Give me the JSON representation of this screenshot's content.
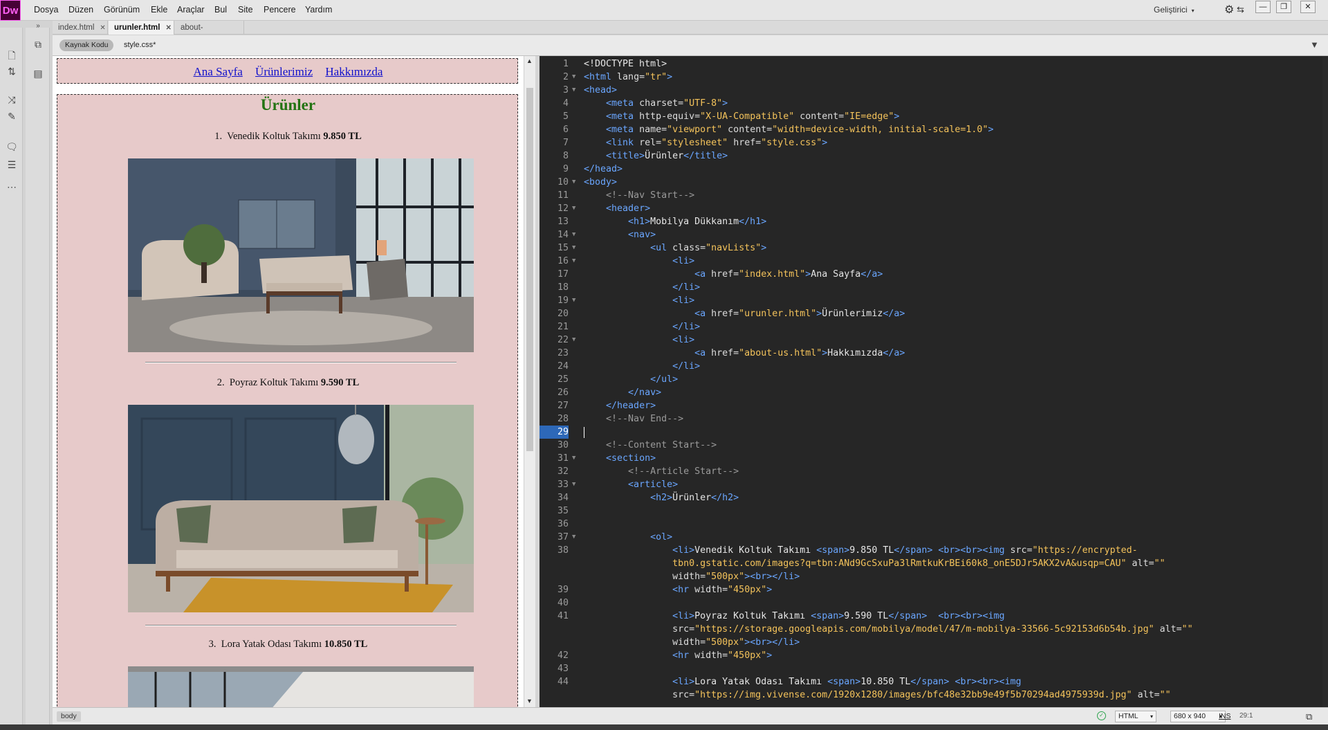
{
  "app": {
    "logo": "Dw"
  },
  "menu": [
    "Dosya",
    "Düzen",
    "Görünüm",
    "Ekle",
    "Araçlar",
    "Bul",
    "Site",
    "Pencere",
    "Yardım"
  ],
  "workspace": {
    "label": "Geliştirici",
    "arrow": "▾"
  },
  "window_controls": {
    "minimize": "—",
    "restore": "❐",
    "close": "✕"
  },
  "tabs": [
    {
      "label": "index.html",
      "close": "✕"
    },
    {
      "label": "urunler.html",
      "close": "✕"
    },
    {
      "label": "about-us.html",
      "close": "✕"
    }
  ],
  "related_files": {
    "source": "Kaynak Kodu",
    "css": "style.css*"
  },
  "live": {
    "nav": [
      "Ana Sayfa",
      "Ürünlerimiz",
      "Hakkımızda"
    ],
    "heading": "Ürünler",
    "products": [
      {
        "num": "1.",
        "name": "Venedik Koltuk Takımı",
        "price": "9.850 TL"
      },
      {
        "num": "2.",
        "name": "Poyraz Koltuk Takımı",
        "price": "9.590 TL"
      },
      {
        "num": "3.",
        "name": "Lora Yatak Odası Takımı",
        "price": "10.850 TL"
      }
    ]
  },
  "code": {
    "current_line": 29,
    "lines": [
      {
        "n": "1",
        "fold": "",
        "segs": [
          [
            "t",
            "<!DOCTYPE html>"
          ]
        ]
      },
      {
        "n": "2",
        "fold": "▼",
        "segs": [
          [
            "g",
            "<html "
          ],
          [
            "a",
            "lang="
          ],
          [
            "s",
            "\"tr\""
          ],
          [
            "g",
            ">"
          ]
        ]
      },
      {
        "n": "3",
        "fold": "▼",
        "segs": [
          [
            "g",
            "<head>"
          ]
        ]
      },
      {
        "n": "4",
        "fold": "",
        "segs": [
          [
            "t",
            "    "
          ],
          [
            "g",
            "<meta "
          ],
          [
            "a",
            "charset="
          ],
          [
            "s",
            "\"UTF-8\""
          ],
          [
            "g",
            ">"
          ]
        ]
      },
      {
        "n": "5",
        "fold": "",
        "segs": [
          [
            "t",
            "    "
          ],
          [
            "g",
            "<meta "
          ],
          [
            "a",
            "http-equiv="
          ],
          [
            "s",
            "\"X-UA-Compatible\""
          ],
          [
            "a",
            " content="
          ],
          [
            "s",
            "\"IE=edge\""
          ],
          [
            "g",
            ">"
          ]
        ]
      },
      {
        "n": "6",
        "fold": "",
        "segs": [
          [
            "t",
            "    "
          ],
          [
            "g",
            "<meta "
          ],
          [
            "a",
            "name="
          ],
          [
            "s",
            "\"viewport\""
          ],
          [
            "a",
            " content="
          ],
          [
            "s",
            "\"width=device-width, initial-scale=1.0\""
          ],
          [
            "g",
            ">"
          ]
        ]
      },
      {
        "n": "7",
        "fold": "",
        "segs": [
          [
            "t",
            "    "
          ],
          [
            "g",
            "<link "
          ],
          [
            "a",
            "rel="
          ],
          [
            "s",
            "\"stylesheet\""
          ],
          [
            "a",
            " href="
          ],
          [
            "s",
            "\"style.css\""
          ],
          [
            "g",
            ">"
          ]
        ]
      },
      {
        "n": "8",
        "fold": "",
        "segs": [
          [
            "t",
            "    "
          ],
          [
            "g",
            "<title>"
          ],
          [
            "t",
            "Ürünler"
          ],
          [
            "g",
            "</title>"
          ]
        ]
      },
      {
        "n": "9",
        "fold": "",
        "segs": [
          [
            "g",
            "</head>"
          ]
        ]
      },
      {
        "n": "10",
        "fold": "▼",
        "segs": [
          [
            "g",
            "<body>"
          ]
        ]
      },
      {
        "n": "11",
        "fold": "",
        "segs": [
          [
            "t",
            "    "
          ],
          [
            "c",
            "<!--Nav Start-->"
          ]
        ]
      },
      {
        "n": "12",
        "fold": "▼",
        "segs": [
          [
            "t",
            "    "
          ],
          [
            "g",
            "<header>"
          ]
        ]
      },
      {
        "n": "13",
        "fold": "",
        "segs": [
          [
            "t",
            "        "
          ],
          [
            "g",
            "<h1>"
          ],
          [
            "t",
            "Mobilya Dükkanım"
          ],
          [
            "g",
            "</h1>"
          ]
        ]
      },
      {
        "n": "14",
        "fold": "▼",
        "segs": [
          [
            "t",
            "        "
          ],
          [
            "g",
            "<nav>"
          ]
        ]
      },
      {
        "n": "15",
        "fold": "▼",
        "segs": [
          [
            "t",
            "            "
          ],
          [
            "g",
            "<ul "
          ],
          [
            "a",
            "class="
          ],
          [
            "s",
            "\"navLists\""
          ],
          [
            "g",
            ">"
          ]
        ]
      },
      {
        "n": "16",
        "fold": "▼",
        "segs": [
          [
            "t",
            "                "
          ],
          [
            "g",
            "<li>"
          ]
        ]
      },
      {
        "n": "17",
        "fold": "",
        "segs": [
          [
            "t",
            "                    "
          ],
          [
            "g",
            "<a "
          ],
          [
            "a",
            "href="
          ],
          [
            "s",
            "\"index.html\""
          ],
          [
            "g",
            ">"
          ],
          [
            "t",
            "Ana Sayfa"
          ],
          [
            "g",
            "</a>"
          ]
        ]
      },
      {
        "n": "18",
        "fold": "",
        "segs": [
          [
            "t",
            "                "
          ],
          [
            "g",
            "</li>"
          ]
        ]
      },
      {
        "n": "19",
        "fold": "▼",
        "segs": [
          [
            "t",
            "                "
          ],
          [
            "g",
            "<li>"
          ]
        ]
      },
      {
        "n": "20",
        "fold": "",
        "segs": [
          [
            "t",
            "                    "
          ],
          [
            "g",
            "<a "
          ],
          [
            "a",
            "href="
          ],
          [
            "s",
            "\"urunler.html\""
          ],
          [
            "g",
            ">"
          ],
          [
            "t",
            "Ürünlerimiz"
          ],
          [
            "g",
            "</a>"
          ]
        ]
      },
      {
        "n": "21",
        "fold": "",
        "segs": [
          [
            "t",
            "                "
          ],
          [
            "g",
            "</li>"
          ]
        ]
      },
      {
        "n": "22",
        "fold": "▼",
        "segs": [
          [
            "t",
            "                "
          ],
          [
            "g",
            "<li>"
          ]
        ]
      },
      {
        "n": "23",
        "fold": "",
        "segs": [
          [
            "t",
            "                    "
          ],
          [
            "g",
            "<a "
          ],
          [
            "a",
            "href="
          ],
          [
            "s",
            "\"about-us.html\""
          ],
          [
            "g",
            ">"
          ],
          [
            "t",
            "Hakkımızda"
          ],
          [
            "g",
            "</a>"
          ]
        ]
      },
      {
        "n": "24",
        "fold": "",
        "segs": [
          [
            "t",
            "                "
          ],
          [
            "g",
            "</li>"
          ]
        ]
      },
      {
        "n": "25",
        "fold": "",
        "segs": [
          [
            "t",
            "            "
          ],
          [
            "g",
            "</ul>"
          ]
        ]
      },
      {
        "n": "26",
        "fold": "",
        "segs": [
          [
            "t",
            "        "
          ],
          [
            "g",
            "</nav>"
          ]
        ]
      },
      {
        "n": "27",
        "fold": "",
        "segs": [
          [
            "t",
            "    "
          ],
          [
            "g",
            "</header>"
          ]
        ]
      },
      {
        "n": "28",
        "fold": "",
        "segs": [
          [
            "t",
            "    "
          ],
          [
            "c",
            "<!--Nav End-->"
          ]
        ]
      },
      {
        "n": "29",
        "fold": "",
        "segs": []
      },
      {
        "n": "30",
        "fold": "",
        "segs": [
          [
            "t",
            "    "
          ],
          [
            "c",
            "<!--Content Start-->"
          ]
        ]
      },
      {
        "n": "31",
        "fold": "▼",
        "segs": [
          [
            "t",
            "    "
          ],
          [
            "g",
            "<section>"
          ]
        ]
      },
      {
        "n": "32",
        "fold": "",
        "segs": [
          [
            "t",
            "        "
          ],
          [
            "c",
            "<!--Article Start-->"
          ]
        ]
      },
      {
        "n": "33",
        "fold": "▼",
        "segs": [
          [
            "t",
            "        "
          ],
          [
            "g",
            "<article>"
          ]
        ]
      },
      {
        "n": "34",
        "fold": "",
        "segs": [
          [
            "t",
            "            "
          ],
          [
            "g",
            "<h2>"
          ],
          [
            "t",
            "Ürünler"
          ],
          [
            "g",
            "</h2>"
          ]
        ]
      },
      {
        "n": "35",
        "fold": "",
        "segs": []
      },
      {
        "n": "36",
        "fold": "",
        "segs": []
      },
      {
        "n": "37",
        "fold": "▼",
        "segs": [
          [
            "t",
            "            "
          ],
          [
            "g",
            "<ol>"
          ]
        ]
      },
      {
        "n": "38",
        "fold": "",
        "segs": [
          [
            "t",
            "                "
          ],
          [
            "g",
            "<li>"
          ],
          [
            "t",
            "Venedik Koltuk Takımı "
          ],
          [
            "g",
            "<span>"
          ],
          [
            "t",
            "9.850 TL"
          ],
          [
            "g",
            "</span>"
          ],
          [
            "t",
            " "
          ],
          [
            "g",
            "<br><br><img "
          ],
          [
            "a",
            "src="
          ],
          [
            "s",
            "\"https://encrypted-"
          ]
        ]
      },
      {
        "n": "",
        "fold": "",
        "segs": [
          [
            "t",
            "                "
          ],
          [
            "s",
            "tbn0.gstatic.com/images?q=tbn:ANd9GcSxuPa3lRmtkuKrBEi60k8_onE5DJr5AKX2vA&usqp=CAU\""
          ],
          [
            "a",
            " alt="
          ],
          [
            "s",
            "\"\""
          ]
        ]
      },
      {
        "n": "",
        "fold": "",
        "segs": [
          [
            "t",
            "                "
          ],
          [
            "a",
            "width="
          ],
          [
            "s",
            "\"500px\""
          ],
          [
            "g",
            "><br></li>"
          ]
        ]
      },
      {
        "n": "39",
        "fold": "",
        "segs": [
          [
            "t",
            "                "
          ],
          [
            "g",
            "<hr "
          ],
          [
            "a",
            "width="
          ],
          [
            "s",
            "\"450px\""
          ],
          [
            "g",
            ">"
          ]
        ]
      },
      {
        "n": "40",
        "fold": "",
        "segs": []
      },
      {
        "n": "41",
        "fold": "",
        "segs": [
          [
            "t",
            "                "
          ],
          [
            "g",
            "<li>"
          ],
          [
            "t",
            "Poyraz Koltuk Takımı "
          ],
          [
            "g",
            "<span>"
          ],
          [
            "t",
            "9.590 TL"
          ],
          [
            "g",
            "</span>"
          ],
          [
            "t",
            "  "
          ],
          [
            "g",
            "<br><br><img"
          ]
        ]
      },
      {
        "n": "",
        "fold": "",
        "segs": [
          [
            "t",
            "                "
          ],
          [
            "a",
            "src="
          ],
          [
            "s",
            "\"https://storage.googleapis.com/mobilya/model/47/m-mobilya-33566-5c92153d6b54b.jpg\""
          ],
          [
            "a",
            " alt="
          ],
          [
            "s",
            "\"\""
          ]
        ]
      },
      {
        "n": "",
        "fold": "",
        "segs": [
          [
            "t",
            "                "
          ],
          [
            "a",
            "width="
          ],
          [
            "s",
            "\"500px\""
          ],
          [
            "g",
            "><br></li>"
          ]
        ]
      },
      {
        "n": "42",
        "fold": "",
        "segs": [
          [
            "t",
            "                "
          ],
          [
            "g",
            "<hr "
          ],
          [
            "a",
            "width="
          ],
          [
            "s",
            "\"450px\""
          ],
          [
            "g",
            ">"
          ]
        ]
      },
      {
        "n": "43",
        "fold": "",
        "segs": []
      },
      {
        "n": "44",
        "fold": "",
        "segs": [
          [
            "t",
            "                "
          ],
          [
            "g",
            "<li>"
          ],
          [
            "t",
            "Lora Yatak Odası Takımı "
          ],
          [
            "g",
            "<span>"
          ],
          [
            "t",
            "10.850 TL"
          ],
          [
            "g",
            "</span>"
          ],
          [
            "t",
            " "
          ],
          [
            "g",
            "<br><br><img"
          ]
        ]
      },
      {
        "n": "",
        "fold": "",
        "segs": [
          [
            "t",
            "                "
          ],
          [
            "a",
            "src="
          ],
          [
            "s",
            "\"https://img.vivense.com/1920x1280/images/bfc48e32bb9e49f5b70294ad4975939d.jpg\""
          ],
          [
            "a",
            " alt="
          ],
          [
            "s",
            "\"\""
          ]
        ]
      }
    ]
  },
  "status": {
    "tag": "body",
    "ok": "✓",
    "doc_type": "HTML",
    "size": "680 x 940",
    "ins": "INS",
    "pos": "29:1"
  }
}
